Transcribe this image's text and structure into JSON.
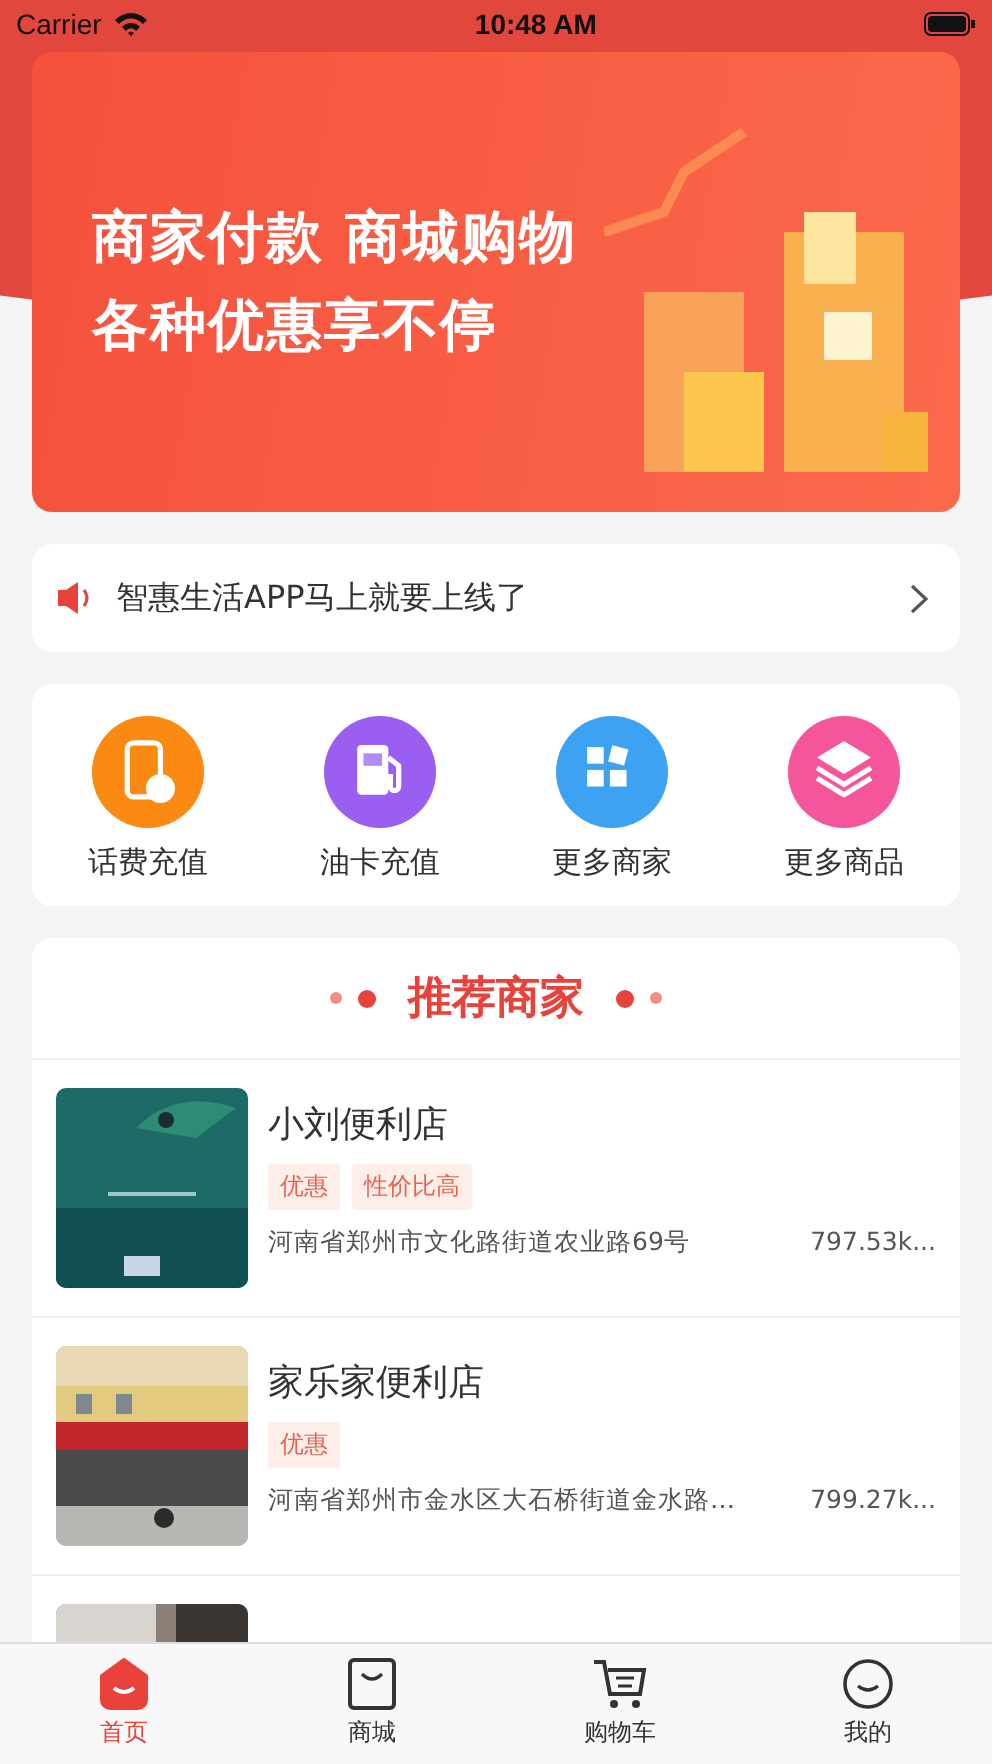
{
  "status_bar": {
    "carrier": "Carrier",
    "time": "10:48 AM"
  },
  "banner": {
    "lines": [
      "商家付款 商城购物",
      "各种优惠享不停"
    ]
  },
  "notice": {
    "text": "智惠生活APP马上就要上线了"
  },
  "shortcuts": [
    {
      "label": "话费充值",
      "kind": "phone",
      "color": "#fb8a12"
    },
    {
      "label": "油卡充值",
      "kind": "fuel",
      "color": "#9a5ef0"
    },
    {
      "label": "更多商家",
      "kind": "grid",
      "color": "#3ea2f2"
    },
    {
      "label": "更多商品",
      "kind": "layers",
      "color": "#f5559a"
    }
  ],
  "section": {
    "title": "推荐商家"
  },
  "stores": [
    {
      "kind": "store",
      "name": "小刘便利店",
      "tags": [
        "优惠",
        "性价比高"
      ],
      "address": "河南省郑州市文化路街道农业路69号",
      "distance": "797.53k..."
    },
    {
      "kind": "store",
      "name": "家乐家便利店",
      "tags": [
        "优惠"
      ],
      "address": "河南省郑州市金水区大石桥街道金水路…",
      "distance": "799.27k..."
    },
    {
      "kind": "picture"
    }
  ],
  "tabs": [
    {
      "label": "首页",
      "kind": "home",
      "selected": true
    },
    {
      "label": "商城",
      "kind": "bag",
      "selected": false
    },
    {
      "label": "购物车",
      "kind": "cart",
      "selected": false
    },
    {
      "label": "我的",
      "kind": "face",
      "selected": false
    }
  ]
}
